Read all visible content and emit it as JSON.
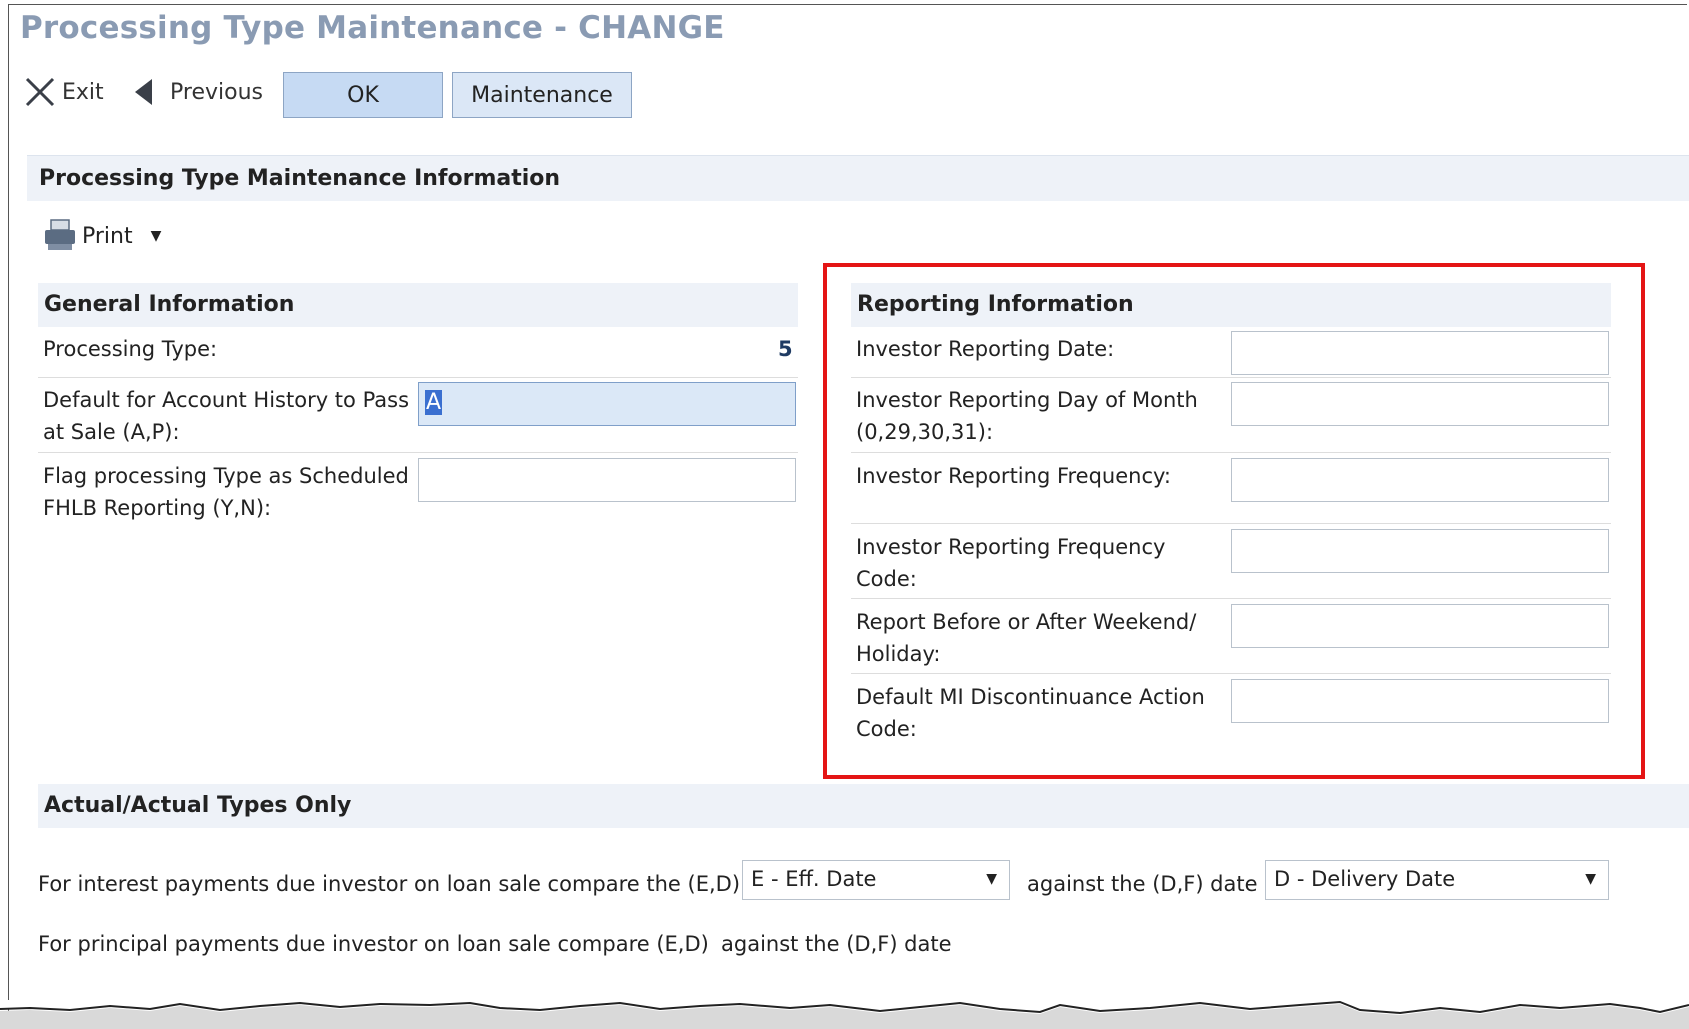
{
  "window": {
    "title": "Processing Type Maintenance - CHANGE"
  },
  "toolbar": {
    "exit_label": "Exit",
    "previous_label": "Previous",
    "ok_label": "OK",
    "maintenance_label": "Maintenance"
  },
  "panel": {
    "title": "Processing Type Maintenance Information",
    "print_label": "Print"
  },
  "general": {
    "title": "General Information",
    "processing_type_label": "Processing Type:",
    "processing_type_value": "5",
    "account_history_label_1": "Default for Account History to Pass",
    "account_history_label_2": "at Sale (A,P):",
    "account_history_value": "A",
    "fhlb_label_1": "Flag processing Type as Scheduled",
    "fhlb_label_2": "FHLB Reporting (Y,N):"
  },
  "reporting": {
    "title": "Reporting Information",
    "date_label": "Investor Reporting Date:",
    "day_label_1": "Investor Reporting Day of Month",
    "day_label_2": "(0,29,30,31):",
    "freq_label": "Investor Reporting Frequency:",
    "freq_code_label_1": "Investor Reporting Frequency",
    "freq_code_label_2": "Code:",
    "weekend_label_1": "Report Before or After Weekend/",
    "weekend_label_2": "Holiday:",
    "mi_label_1": "Default MI Discontinuance Action",
    "mi_label_2": "Code:"
  },
  "actual": {
    "title": "Actual/Actual Types Only",
    "interest_prefix": "For interest payments due investor on loan sale compare the (E,D)",
    "interest_select_value": "E - Eff. Date",
    "interest_middle": "against the (D,F) date",
    "interest_select2_value": "D - Delivery Date",
    "principal_prefix": "For principal payments due investor on loan sale compare (E,D)",
    "principal_suffix": "against the (D,F) date"
  }
}
